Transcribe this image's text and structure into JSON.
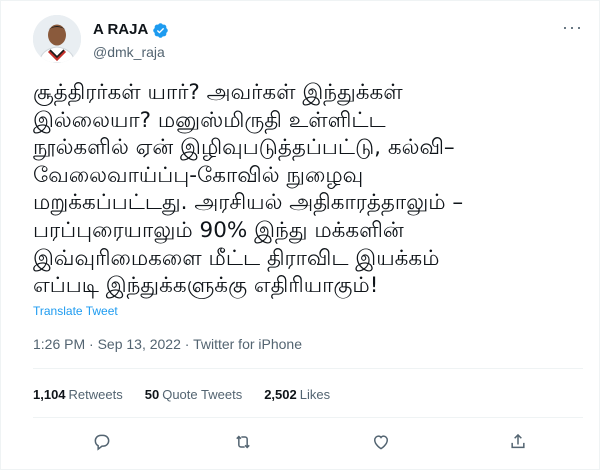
{
  "user": {
    "display_name": "A RAJA",
    "handle": "@dmk_raja",
    "verified": true
  },
  "tweet": {
    "text": "சூத்திரர்கள் யார்? அவர்கள் இந்துக்கள்\nஇல்லையா? மனுஸ்மிருதி உள்ளிட்ட\nநூல்களில் ஏன் இழிவுபடுத்தப்பட்டு, கல்வி–\nவேலைவாய்ப்பு-கோவில் நுழைவு\nமறுக்கப்பட்டது. அரசியல் அதிகாரத்தாலும் –\nபரப்புரையாலும் 90% இந்து மக்களின்\nஇவ்வுரிமைகளை மீட்ட திராவிட இயக்கம்\nஎப்படி இந்துக்களுக்கு எதிரியாகும்!",
    "translate_label": "Translate Tweet",
    "timestamp": "1:26 PM · Sep 13, 2022 · Twitter for iPhone"
  },
  "stats": {
    "retweets_count": "1,104",
    "retweets_label": "Retweets",
    "quotes_count": "50",
    "quotes_label": "Quote Tweets",
    "likes_count": "2,502",
    "likes_label": "Likes"
  },
  "colors": {
    "accent": "#1d9bf0",
    "secondary_text": "#536471",
    "divider": "#eff3f4"
  },
  "icons": {
    "more": "more-dots-icon",
    "reply": "reply-icon",
    "retweet": "retweet-icon",
    "like": "heart-icon",
    "share": "share-icon",
    "verified": "verified-badge-icon"
  }
}
